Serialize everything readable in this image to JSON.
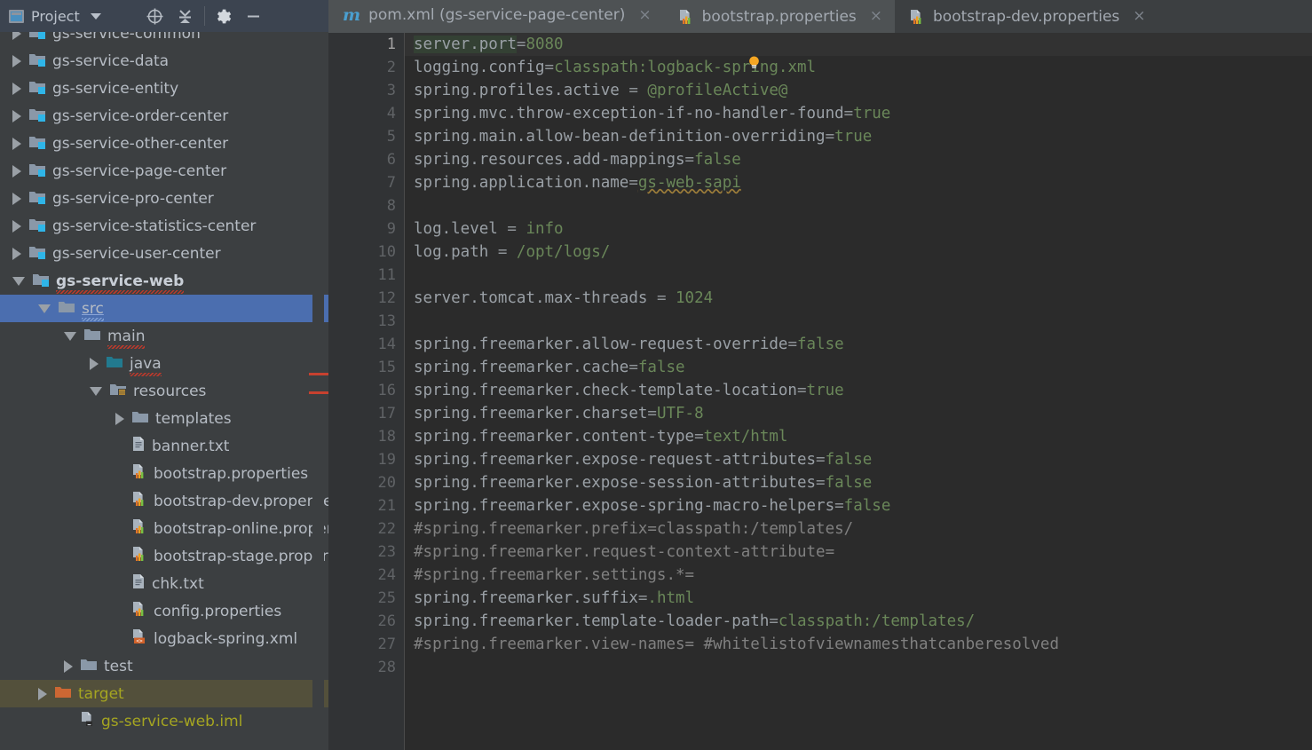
{
  "window": {
    "panel_title": "Project",
    "toolbar_icons": [
      "locate-target-icon",
      "collapse-all-icon",
      "settings-gear-icon",
      "minimize-icon"
    ],
    "colors": {
      "panel_bg": "#3c3f41",
      "header_bg": "#3c4450",
      "editor_bg": "#2b2b2b",
      "gutter_bg": "#313335",
      "selection_blue": "#4b6eaf",
      "highlight_olive": "#53503b",
      "tab_active_bg": "#4e5254",
      "string_green": "#6a8759",
      "key_gray": "#9aa0a6",
      "comment_gray": "#808080",
      "error_red": "#c7412f",
      "target_folder_orange": "#cc6733",
      "java_folder_teal": "#227a8f",
      "iml_olive_text": "#a5a521"
    }
  },
  "tabs": [
    {
      "label": "pom.xml (gs-service-page-center)",
      "icon": "maven-m-icon",
      "close": "×",
      "active": false
    },
    {
      "label": "bootstrap.properties",
      "icon": "properties-file-icon",
      "close": "×",
      "active": true
    },
    {
      "label": "bootstrap-dev.properties",
      "icon": "properties-file-icon",
      "close": "×",
      "active": false
    }
  ],
  "tree": [
    {
      "label": "gs-service-common",
      "indent": 1,
      "arrow": "right",
      "icon": "module-folder-icon",
      "state": "clipped",
      "bold": false
    },
    {
      "label": "gs-service-data",
      "indent": 1,
      "arrow": "right",
      "icon": "module-folder-icon",
      "state": "normal",
      "bold": false
    },
    {
      "label": "gs-service-entity",
      "indent": 1,
      "arrow": "right",
      "icon": "module-folder-icon",
      "state": "normal",
      "bold": false
    },
    {
      "label": "gs-service-order-center",
      "indent": 1,
      "arrow": "right",
      "icon": "module-folder-icon",
      "state": "normal",
      "bold": false
    },
    {
      "label": "gs-service-other-center",
      "indent": 1,
      "arrow": "right",
      "icon": "module-folder-icon",
      "state": "normal",
      "bold": false
    },
    {
      "label": "gs-service-page-center",
      "indent": 1,
      "arrow": "right",
      "icon": "module-folder-icon",
      "state": "normal",
      "bold": false
    },
    {
      "label": "gs-service-pro-center",
      "indent": 1,
      "arrow": "right",
      "icon": "module-folder-icon",
      "state": "normal",
      "bold": false
    },
    {
      "label": "gs-service-statistics-center",
      "indent": 1,
      "arrow": "right",
      "icon": "module-folder-icon",
      "state": "normal",
      "bold": false
    },
    {
      "label": "gs-service-user-center",
      "indent": 1,
      "arrow": "right",
      "icon": "module-folder-icon",
      "state": "normal",
      "bold": false
    },
    {
      "label": "gs-service-web",
      "indent": 1,
      "arrow": "down",
      "icon": "module-folder-icon",
      "state": "error",
      "bold": true
    },
    {
      "label": "src",
      "indent": 2,
      "arrow": "down",
      "icon": "folder-icon",
      "state": "selected",
      "bold": false
    },
    {
      "label": "main",
      "indent": 3,
      "arrow": "down",
      "icon": "folder-icon",
      "state": "error",
      "bold": false
    },
    {
      "label": "java",
      "indent": 4,
      "arrow": "right",
      "icon": "source-folder-icon",
      "state": "error",
      "bold": false
    },
    {
      "label": "resources",
      "indent": 4,
      "arrow": "down",
      "icon": "resources-folder-icon",
      "state": "normal",
      "bold": false
    },
    {
      "label": "templates",
      "indent": 5,
      "arrow": "right",
      "icon": "folder-icon",
      "state": "normal",
      "bold": false
    },
    {
      "label": "banner.txt",
      "indent": 5,
      "arrow": "none",
      "icon": "text-file-icon",
      "state": "normal",
      "bold": false
    },
    {
      "label": "bootstrap.properties",
      "indent": 5,
      "arrow": "none",
      "icon": "properties-file-icon",
      "state": "normal",
      "bold": false
    },
    {
      "label": "bootstrap-dev.properties",
      "indent": 5,
      "arrow": "none",
      "icon": "properties-file-icon",
      "state": "normal",
      "bold": false
    },
    {
      "label": "bootstrap-online.properties",
      "indent": 5,
      "arrow": "none",
      "icon": "properties-file-icon",
      "state": "normal",
      "bold": false
    },
    {
      "label": "bootstrap-stage.properties",
      "indent": 5,
      "arrow": "none",
      "icon": "properties-file-icon",
      "state": "normal",
      "bold": false
    },
    {
      "label": "chk.txt",
      "indent": 5,
      "arrow": "none",
      "icon": "text-file-icon",
      "state": "normal",
      "bold": false
    },
    {
      "label": "config.properties",
      "indent": 5,
      "arrow": "none",
      "icon": "properties-file-icon",
      "state": "normal",
      "bold": false
    },
    {
      "label": "logback-spring.xml",
      "indent": 5,
      "arrow": "none",
      "icon": "xml-file-icon",
      "state": "normal",
      "bold": false
    },
    {
      "label": "test",
      "indent": 3,
      "arrow": "right",
      "icon": "folder-icon",
      "state": "normal",
      "bold": false
    },
    {
      "label": "target",
      "indent": 2,
      "arrow": "right",
      "icon": "excluded-folder-icon",
      "state": "highlight",
      "bold": false
    },
    {
      "label": "gs-service-web.iml",
      "indent": 3,
      "arrow": "none",
      "icon": "iml-file-icon",
      "state": "olive",
      "bold": false
    }
  ],
  "editor": {
    "current_line": 1,
    "total_visible_lines": 28,
    "selected_text": "server.port",
    "bulb_icon": "intention-bulb-icon",
    "lines": [
      {
        "n": 1,
        "parts": [
          {
            "t": "server.port",
            "c": "k sel"
          },
          {
            "t": "=",
            "c": "eq"
          },
          {
            "t": "8080",
            "c": "v"
          }
        ]
      },
      {
        "n": 2,
        "parts": [
          {
            "t": "logging.config",
            "c": "k"
          },
          {
            "t": "=",
            "c": "eq"
          },
          {
            "t": "classpath:logback-spring.xml",
            "c": "v"
          }
        ]
      },
      {
        "n": 3,
        "parts": [
          {
            "t": "spring.profiles.active ",
            "c": "k"
          },
          {
            "t": "= ",
            "c": "eq"
          },
          {
            "t": "@profileActive@",
            "c": "v"
          }
        ]
      },
      {
        "n": 4,
        "parts": [
          {
            "t": "spring.mvc.throw-exception-if-no-handler-found",
            "c": "k"
          },
          {
            "t": "=",
            "c": "eq"
          },
          {
            "t": "true",
            "c": "v"
          }
        ]
      },
      {
        "n": 5,
        "parts": [
          {
            "t": "spring.main.allow-bean-definition-overriding",
            "c": "k"
          },
          {
            "t": "=",
            "c": "eq"
          },
          {
            "t": "true",
            "c": "v"
          }
        ]
      },
      {
        "n": 6,
        "parts": [
          {
            "t": "spring.resources.add-mappings",
            "c": "k"
          },
          {
            "t": "=",
            "c": "eq"
          },
          {
            "t": "false",
            "c": "v"
          }
        ]
      },
      {
        "n": 7,
        "parts": [
          {
            "t": "spring.application.name",
            "c": "k"
          },
          {
            "t": "=",
            "c": "eq"
          },
          {
            "t": "gs-web-sapi",
            "c": "v tw"
          }
        ]
      },
      {
        "n": 8,
        "parts": []
      },
      {
        "n": 9,
        "parts": [
          {
            "t": "log.level ",
            "c": "k"
          },
          {
            "t": "= ",
            "c": "eq"
          },
          {
            "t": "info",
            "c": "v"
          }
        ]
      },
      {
        "n": 10,
        "parts": [
          {
            "t": "log.path ",
            "c": "k"
          },
          {
            "t": "= ",
            "c": "eq"
          },
          {
            "t": "/opt/logs/",
            "c": "v"
          }
        ]
      },
      {
        "n": 11,
        "parts": []
      },
      {
        "n": 12,
        "parts": [
          {
            "t": "server.tomcat.max-threads ",
            "c": "k"
          },
          {
            "t": "= ",
            "c": "eq"
          },
          {
            "t": "1024",
            "c": "v"
          }
        ]
      },
      {
        "n": 13,
        "parts": []
      },
      {
        "n": 14,
        "parts": [
          {
            "t": "spring.freemarker.allow-request-override",
            "c": "k"
          },
          {
            "t": "=",
            "c": "eq"
          },
          {
            "t": "false",
            "c": "v"
          }
        ]
      },
      {
        "n": 15,
        "parts": [
          {
            "t": "spring.freemarker.cache",
            "c": "k"
          },
          {
            "t": "=",
            "c": "eq"
          },
          {
            "t": "false",
            "c": "v"
          }
        ]
      },
      {
        "n": 16,
        "parts": [
          {
            "t": "spring.freemarker.check-template-location",
            "c": "k"
          },
          {
            "t": "=",
            "c": "eq"
          },
          {
            "t": "true",
            "c": "v"
          }
        ]
      },
      {
        "n": 17,
        "parts": [
          {
            "t": "spring.freemarker.charset",
            "c": "k"
          },
          {
            "t": "=",
            "c": "eq"
          },
          {
            "t": "UTF-8",
            "c": "v"
          }
        ]
      },
      {
        "n": 18,
        "parts": [
          {
            "t": "spring.freemarker.content-type",
            "c": "k"
          },
          {
            "t": "=",
            "c": "eq"
          },
          {
            "t": "text/html",
            "c": "v"
          }
        ]
      },
      {
        "n": 19,
        "parts": [
          {
            "t": "spring.freemarker.expose-request-attributes",
            "c": "k"
          },
          {
            "t": "=",
            "c": "eq"
          },
          {
            "t": "false",
            "c": "v"
          }
        ]
      },
      {
        "n": 20,
        "parts": [
          {
            "t": "spring.freemarker.expose-session-attributes",
            "c": "k"
          },
          {
            "t": "=",
            "c": "eq"
          },
          {
            "t": "false",
            "c": "v"
          }
        ]
      },
      {
        "n": 21,
        "parts": [
          {
            "t": "spring.freemarker.expose-spring-macro-helpers",
            "c": "k"
          },
          {
            "t": "=",
            "c": "eq"
          },
          {
            "t": "false",
            "c": "v"
          }
        ]
      },
      {
        "n": 22,
        "parts": [
          {
            "t": "#spring.freemarker.prefix=classpath:/templates/",
            "c": "cm"
          }
        ]
      },
      {
        "n": 23,
        "parts": [
          {
            "t": "#spring.freemarker.request-context-attribute=",
            "c": "cm"
          }
        ]
      },
      {
        "n": 24,
        "parts": [
          {
            "t": "#spring.freemarker.settings.*=",
            "c": "cm"
          }
        ]
      },
      {
        "n": 25,
        "parts": [
          {
            "t": "spring.freemarker.suffix",
            "c": "k"
          },
          {
            "t": "=",
            "c": "eq"
          },
          {
            "t": ".html",
            "c": "v"
          }
        ]
      },
      {
        "n": 26,
        "parts": [
          {
            "t": "spring.freemarker.template-loader-path",
            "c": "k"
          },
          {
            "t": "=",
            "c": "eq"
          },
          {
            "t": "classpath:/templates/",
            "c": "v"
          }
        ]
      },
      {
        "n": 27,
        "parts": [
          {
            "t": "#spring.freemarker.view-names= #whitelistofviewnamesthatcanberesolved",
            "c": "cm"
          }
        ]
      },
      {
        "n": 28,
        "parts": []
      }
    ]
  }
}
